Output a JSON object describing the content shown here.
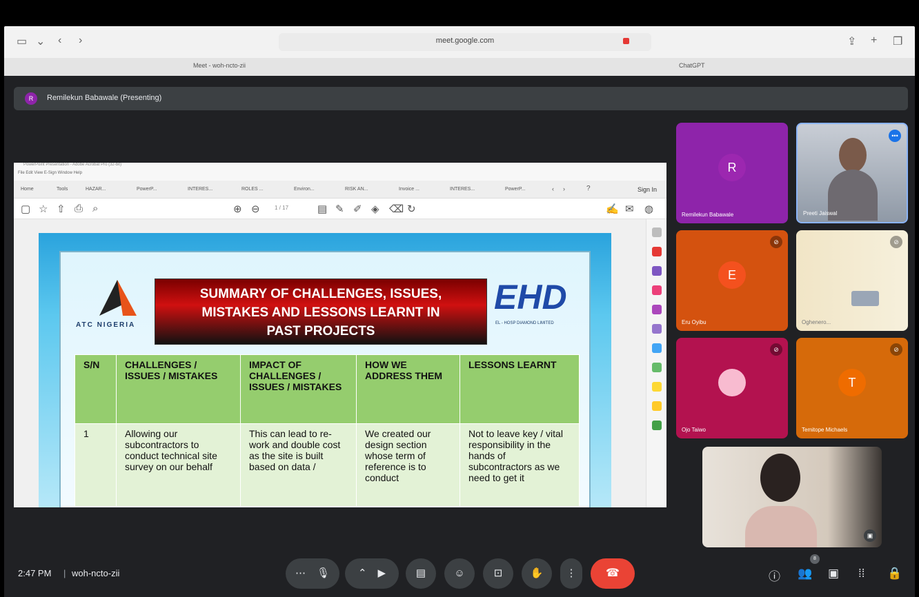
{
  "browser": {
    "url": "meet.google.com",
    "tabs": [
      "Meet - woh-ncto-zii",
      "ChatGPT"
    ]
  },
  "meet": {
    "presenter_label": "Remilekun Babawale (Presenting)",
    "presenter_initial": "R",
    "time": "2:47 PM",
    "meeting_code": "woh-ncto-zii",
    "separator": "|",
    "participants_badge": "8",
    "participants": [
      {
        "name": "Remilekun Babawale",
        "initial": "R",
        "color": "#8e24aa"
      },
      {
        "name": "Preeti Jaiswal",
        "initial": "",
        "color": "#7b8794"
      },
      {
        "name": "Eru Oyibu",
        "initial": "E",
        "color": "#e8590c"
      },
      {
        "name": "Oghenero...",
        "initial": "",
        "color": "#d8c9a4"
      },
      {
        "name": "Ojo Taiwo",
        "initial": "",
        "color": "#c2185b"
      },
      {
        "name": "Temitope Michaels",
        "initial": "T",
        "color": "#ef6c00"
      }
    ]
  },
  "viewer": {
    "window_title": "PowerPoint Presentation - Adobe Acrobat Pro (32-bit)",
    "menu": "File  Edit  View  E-Sign  Window  Help",
    "tabs": [
      "Home",
      "Tools",
      "HAZAR...",
      "PowerP...",
      "INTERES...",
      "ROLES ...",
      "Environ...",
      "RISK AN...",
      "Invoice ...",
      "INTERES...",
      "PowerP..."
    ],
    "sign_in": "Sign In",
    "page_indicator": "1 / 17"
  },
  "slide": {
    "left_logo": "ATC NIGERIA",
    "right_logo": "EHD",
    "right_logo_sub": "EL - HOSP DIAMOND LIMITED",
    "title": "SUMMARY OF CHALLENGES, ISSUES,\nMISTAKES AND LESSONS LEARNT IN\nPAST PROJECTS",
    "headers": [
      "S/N",
      "CHALLENGES / ISSUES / MISTAKES",
      "IMPACT OF CHALLENGES / ISSUES / MISTAKES",
      "HOW WE ADDRESS THEM",
      "LESSONS LEARNT"
    ],
    "row": [
      "1",
      "Allowing our subcontractors to conduct technical site survey on our behalf",
      "This can lead to re-work and double cost as the site is built based on data /",
      "We created our design section whose term of reference is to conduct",
      "Not to leave key / vital responsibility in the hands of subcontractors as we need to get it"
    ]
  },
  "icons": [
    "sidebar-icon",
    "back-icon",
    "forward-icon",
    "share-icon",
    "new-tab-icon",
    "tabs-icon",
    "mic-icon",
    "camera-icon",
    "captions-icon",
    "emoji-icon",
    "present-icon",
    "hand-icon",
    "more-icon",
    "end-call-icon",
    "info-icon",
    "people-icon",
    "chat-icon",
    "activities-icon",
    "host-controls-icon"
  ]
}
